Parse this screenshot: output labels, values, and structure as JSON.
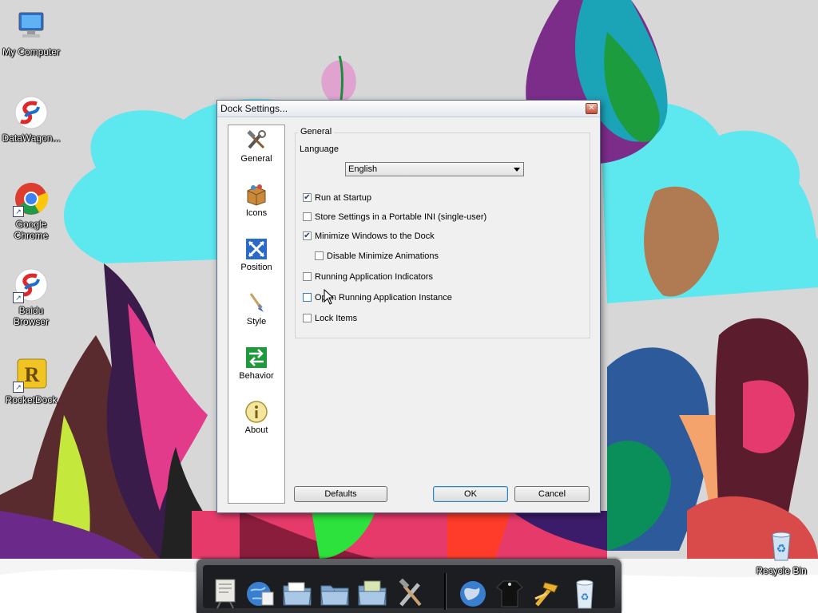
{
  "desktop": {
    "icons": [
      {
        "label": "My Computer",
        "icon": "computer-icon"
      },
      {
        "label": "DataWagon...",
        "icon": "datawagon-icon"
      },
      {
        "label": "Google Chrome",
        "icon": "chrome-icon"
      },
      {
        "label": "Baidu Browser",
        "icon": "baidu-browser-icon"
      },
      {
        "label": "RocketDock",
        "icon": "rocketdock-icon"
      },
      {
        "label": "Recycle Bin",
        "icon": "recycle-bin-icon"
      }
    ]
  },
  "dialog": {
    "title": "Dock Settings...",
    "close_glyph": "✕",
    "nav": [
      {
        "label": "General",
        "icon": "tools-icon"
      },
      {
        "label": "Icons",
        "icon": "icons-box-icon"
      },
      {
        "label": "Position",
        "icon": "position-arrows-icon"
      },
      {
        "label": "Style",
        "icon": "paintbrush-icon"
      },
      {
        "label": "Behavior",
        "icon": "behavior-arrows-icon"
      },
      {
        "label": "About",
        "icon": "info-icon"
      }
    ],
    "general": {
      "group_title": "General",
      "language_label": "Language",
      "language_value": "English",
      "checkboxes": [
        {
          "label": "Run at Startup",
          "checked": true
        },
        {
          "label": "Store Settings in a Portable INI (single-user)",
          "checked": false
        },
        {
          "label": "Minimize Windows to the Dock",
          "checked": true
        },
        {
          "label": "Disable Minimize Animations",
          "checked": false
        },
        {
          "label": "Running Application Indicators",
          "checked": false
        },
        {
          "label": "Open Running Application Instance",
          "checked": false
        },
        {
          "label": "Lock Items",
          "checked": false
        }
      ]
    },
    "buttons": {
      "defaults": "Defaults",
      "ok": "OK",
      "cancel": "Cancel"
    }
  },
  "dock": {
    "items": [
      "presentation-icon",
      "web-globe-icon",
      "folder-documents-icon",
      "folder-music-icon",
      "folder-pictures-icon",
      "tools-icon",
      "earth-icon",
      "shirt-icon",
      "hammer-icon",
      "recycle-bin-icon"
    ]
  },
  "colors": {
    "accent": "#3c7fb1",
    "wallpaper_sky": "#58e6ef",
    "wallpaper_bg": "#d6d6d6"
  }
}
